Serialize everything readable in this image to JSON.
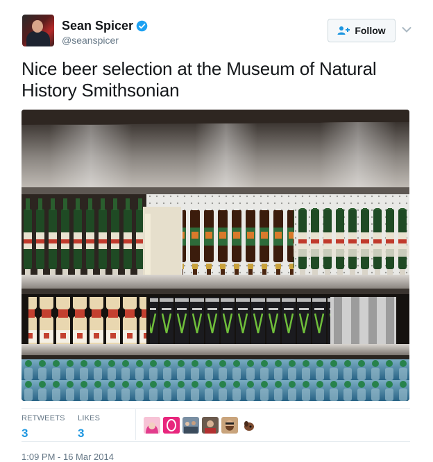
{
  "author": {
    "display_name": "Sean Spicer",
    "handle": "@seanspicer",
    "verified": true
  },
  "follow_button": {
    "label": "Follow"
  },
  "tweet": {
    "text": "Nice beer selection at the Museum of Natural History Smithsonian"
  },
  "stats": {
    "retweets_label": "RETWEETS",
    "retweets_count": "3",
    "likes_label": "LIKES",
    "likes_count": "3"
  },
  "likers": [
    {
      "icon": "pink-hair-avatar-icon"
    },
    {
      "icon": "pink-logo-avatar-icon"
    },
    {
      "icon": "group-avatar-icon"
    },
    {
      "icon": "portrait-avatar-icon"
    },
    {
      "icon": "bearded-avatar-icon"
    },
    {
      "icon": "dog-avatar-icon"
    }
  ],
  "timestamp": "1:09 PM - 16 Mar 2014",
  "colors": {
    "link_blue": "#1b95e0",
    "verified_blue": "#1da1f2",
    "muted_text": "#657786"
  }
}
